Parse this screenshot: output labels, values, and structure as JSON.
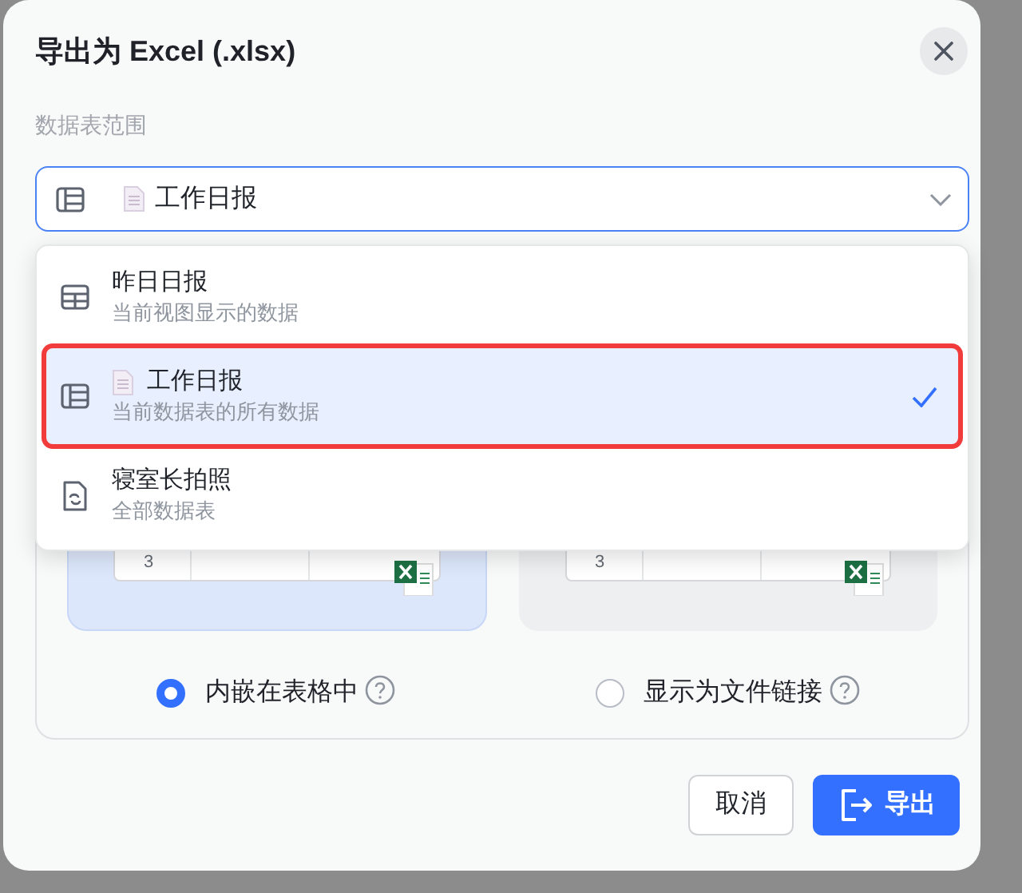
{
  "dialog": {
    "title": "导出为 Excel (.xlsx)"
  },
  "range_label": "数据表范围",
  "select": {
    "value": "工作日报",
    "expanded": true
  },
  "options": [
    {
      "kind": "view",
      "title": "昨日日报",
      "subtitle": "当前视图显示的数据",
      "selected": false,
      "annotated": false
    },
    {
      "kind": "table",
      "title": "工作日报",
      "subtitle": "当前数据表的所有数据",
      "selected": true,
      "annotated": true
    },
    {
      "kind": "form",
      "title": "寝室长拍照",
      "subtitle": "全部数据表",
      "selected": false,
      "annotated": false
    }
  ],
  "preview_cards": [
    {
      "selected": true,
      "cell": "3"
    },
    {
      "selected": false,
      "cell": "3"
    }
  ],
  "attachment_modes": [
    {
      "label": "内嵌在表格中",
      "selected": true
    },
    {
      "label": "显示为文件链接",
      "selected": false
    }
  ],
  "buttons": [
    {
      "kind": "secondary",
      "label": "取消"
    },
    {
      "kind": "primary",
      "label": "导出"
    }
  ]
}
